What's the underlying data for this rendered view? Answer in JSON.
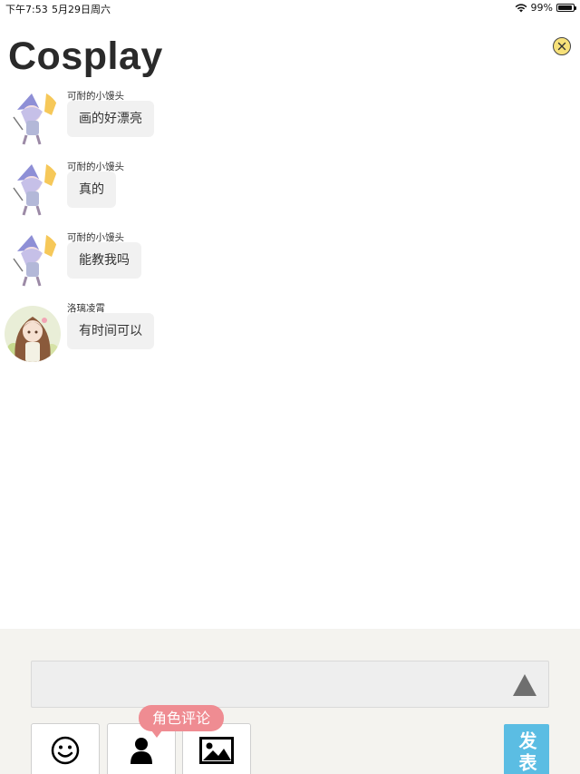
{
  "status_bar": {
    "time": "下午7:53",
    "date": "5月29日周六",
    "battery": "99%"
  },
  "title": "Cosplay",
  "messages": [
    {
      "sender": "可耐的小馒头",
      "text": "画的好漂亮"
    },
    {
      "sender": "可耐的小馒头",
      "text": "真的"
    },
    {
      "sender": "可耐的小馒头",
      "text": "能教我吗"
    },
    {
      "sender": "洛璃凌霄",
      "text": "有时间可以"
    }
  ],
  "composer": {
    "tooltip": "角色评论",
    "send_label": "发表",
    "icons": [
      "smiley-icon",
      "person-icon",
      "image-icon",
      "triangle-up-icon",
      "close-icon",
      "wifi-icon",
      "battery-icon"
    ]
  }
}
